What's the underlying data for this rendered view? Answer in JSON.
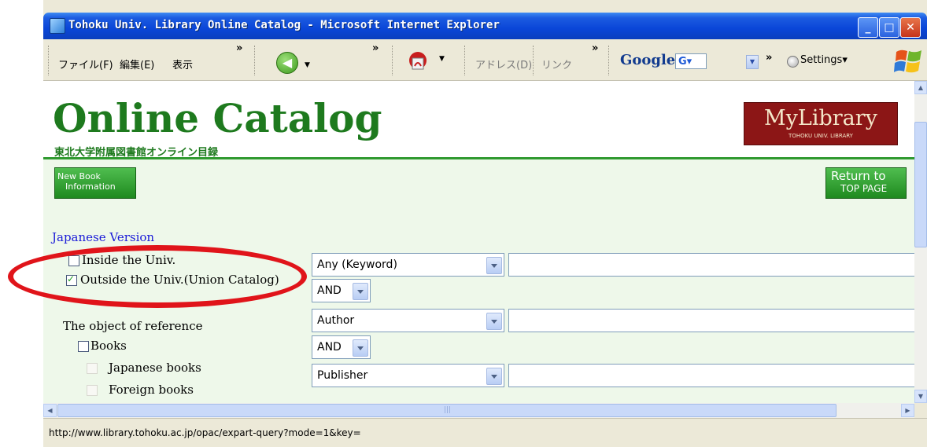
{
  "window": {
    "title": "Tohoku Univ. Library Online Catalog - Microsoft Internet Explorer"
  },
  "toolbar": {
    "menu": [
      "ファイル(F)",
      "編集(E)",
      "表示"
    ],
    "chevron": "»",
    "address_label": "アドレス(D)",
    "links_label": "リンク",
    "google": "Google",
    "google_box": "G▾",
    "settings": "Settings▾"
  },
  "header": {
    "brand": "Online Catalog",
    "subtitle": "東北大学附属図書館オンライン目録",
    "mylibrary": "MyLibrary",
    "mylibrary_sub": "TOHOKU UNIV. LIBRARY"
  },
  "nav": {
    "new_book_line1": "New Book",
    "new_book_line2": "Information",
    "return_line1": "Return to",
    "return_line2": "TOP PAGE"
  },
  "form": {
    "japanese_version": "Japanese Version",
    "scope": [
      {
        "label": "Inside the Univ.",
        "checked": false
      },
      {
        "label": "Outside the Univ.(Union Catalog)",
        "checked": true
      }
    ],
    "object_heading": "The object of reference",
    "objects": [
      {
        "label": "Books",
        "checked": false
      },
      {
        "label": "Japanese books",
        "checked": false
      },
      {
        "label": "Foreign books",
        "checked": false
      }
    ],
    "fields": [
      {
        "field": "Any (Keyword)",
        "value": ""
      },
      {
        "field": "Author",
        "value": ""
      },
      {
        "field": "Publisher",
        "value": ""
      }
    ],
    "operators": [
      "AND",
      "AND"
    ]
  },
  "status_bar": {
    "text": "http://www.library.tohoku.ac.jp/opac/expart-query?mode=1&key="
  },
  "colors": {
    "highlight": "#e0141a",
    "brand_green": "#1e7a1e",
    "mylibrary": "#8c1616"
  }
}
